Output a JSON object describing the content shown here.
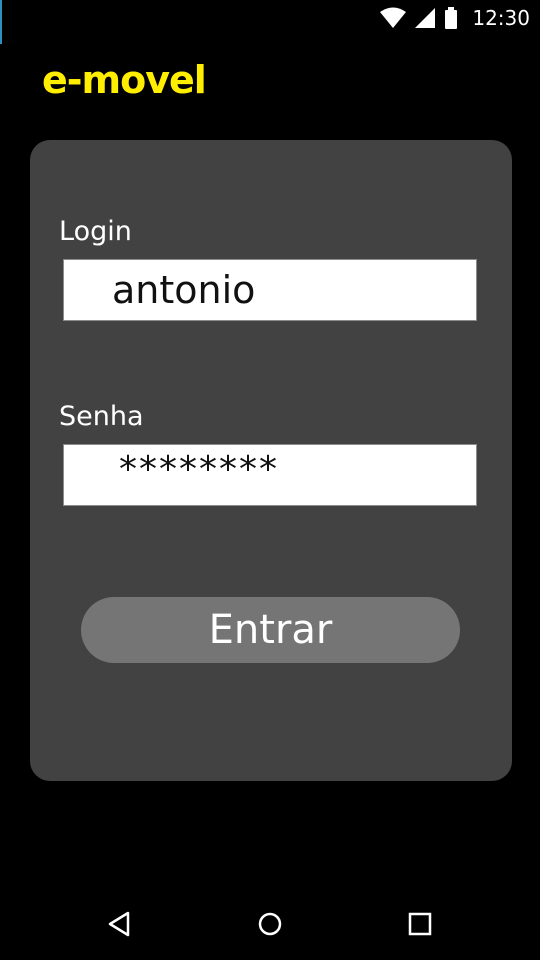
{
  "status_bar": {
    "time": "12:30",
    "icons": [
      "wifi-icon",
      "signal-icon",
      "battery-icon"
    ]
  },
  "app": {
    "title": "e-movel",
    "title_color": "#ffee00"
  },
  "login_form": {
    "login_label": "Login",
    "login_value": "antonio",
    "password_label": "Senha",
    "password_value": "********",
    "submit_label": "Entrar"
  },
  "nav_bar": {
    "icons": [
      "back-icon",
      "home-icon",
      "recents-icon"
    ]
  },
  "colors": {
    "background": "#000000",
    "card": "#424242",
    "button": "#767575"
  }
}
